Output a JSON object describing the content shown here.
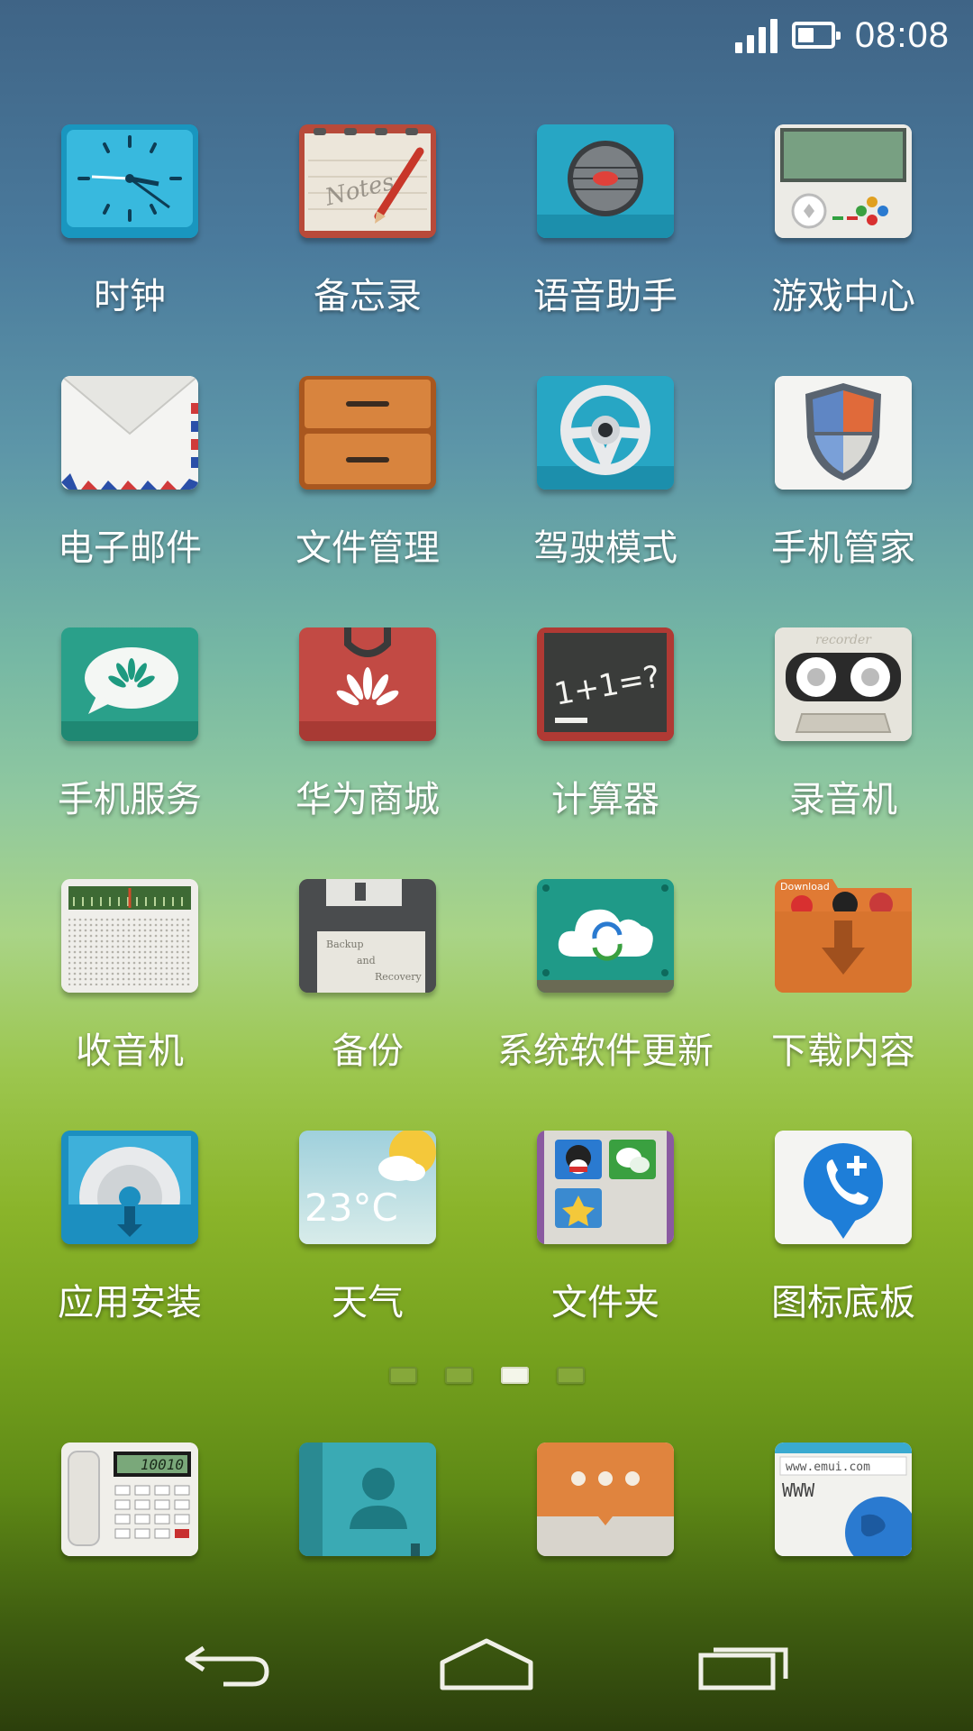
{
  "status_bar": {
    "time": "08:08",
    "battery_level": 0.5
  },
  "apps": [
    {
      "id": "clock",
      "label": "时钟",
      "icon": "clock-icon"
    },
    {
      "id": "notes",
      "label": "备忘录",
      "icon": "notes-icon",
      "icon_text": "Notes"
    },
    {
      "id": "voice-assistant",
      "label": "语音助手",
      "icon": "microphone-icon"
    },
    {
      "id": "game-center",
      "label": "游戏中心",
      "icon": "gamepad-icon"
    },
    {
      "id": "email",
      "label": "电子邮件",
      "icon": "envelope-icon"
    },
    {
      "id": "file-manager",
      "label": "文件管理",
      "icon": "drawer-icon"
    },
    {
      "id": "driving-mode",
      "label": "驾驶模式",
      "icon": "steering-wheel-icon"
    },
    {
      "id": "phone-manager",
      "label": "手机管家",
      "icon": "shield-icon"
    },
    {
      "id": "phone-service",
      "label": "手机服务",
      "icon": "speech-bubble-icon"
    },
    {
      "id": "huawei-store",
      "label": "华为商城",
      "icon": "shopping-bag-icon"
    },
    {
      "id": "calculator",
      "label": "计算器",
      "icon": "chalkboard-icon",
      "icon_text": "1+1=?"
    },
    {
      "id": "recorder",
      "label": "录音机",
      "icon": "cassette-icon",
      "icon_text": "recorder"
    },
    {
      "id": "radio",
      "label": "收音机",
      "icon": "radio-icon"
    },
    {
      "id": "backup",
      "label": "备份",
      "icon": "floppy-disk-icon",
      "icon_text": [
        "Backup",
        "and",
        "Recovery"
      ]
    },
    {
      "id": "system-update",
      "label": "系统软件更新",
      "icon": "cloud-sync-icon"
    },
    {
      "id": "downloads",
      "label": "下载内容",
      "icon": "download-folder-icon",
      "icon_text": "Download"
    },
    {
      "id": "app-install",
      "label": "应用安装",
      "icon": "disc-install-icon"
    },
    {
      "id": "weather",
      "label": "天气",
      "icon": "weather-icon",
      "icon_text": "23°C"
    },
    {
      "id": "folder",
      "label": "文件夹",
      "icon": "folder-icon"
    },
    {
      "id": "icon-board",
      "label": "图标底板",
      "icon": "phone-plus-icon"
    }
  ],
  "pages": {
    "count": 4,
    "current_index": 2
  },
  "dock": [
    {
      "id": "phone",
      "icon": "telephone-icon",
      "icon_text": "10010"
    },
    {
      "id": "contacts",
      "icon": "contacts-icon"
    },
    {
      "id": "messages",
      "icon": "messages-icon"
    },
    {
      "id": "browser",
      "icon": "browser-icon",
      "icon_text": [
        "www.emui.com",
        "WWW"
      ]
    }
  ],
  "nav": {
    "back": "back-icon",
    "home": "home-icon",
    "recents": "recents-icon"
  }
}
